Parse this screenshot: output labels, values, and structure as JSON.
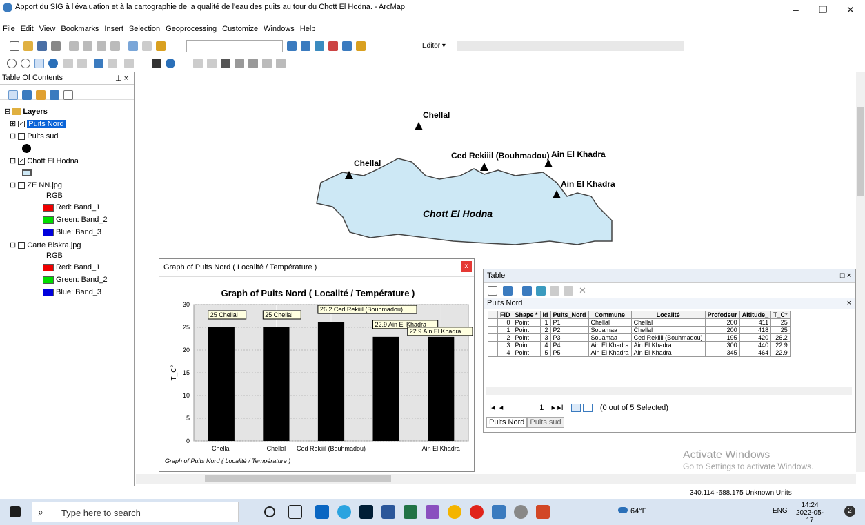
{
  "window": {
    "title": "Apport du SIG à l'évaluation et à la cartographie de la qualité de l'eau des puits au tour du Chott El Hodna. - ArcMap",
    "minimize": "–",
    "maximize": "❐",
    "close": "✕"
  },
  "menu": [
    "File",
    "Edit",
    "View",
    "Bookmarks",
    "Insert",
    "Selection",
    "Geoprocessing",
    "Customize",
    "Windows",
    "Help"
  ],
  "editor_label": "Editor ▾",
  "toc": {
    "title": "Table Of Contents",
    "pin": "⊥ ×",
    "layers_label": "Layers",
    "items": [
      {
        "label": "Puits Nord",
        "checked": "✓"
      },
      {
        "label": "Puits sud",
        "checked": ""
      },
      {
        "label": "Chott El Hodna",
        "checked": "✓"
      },
      {
        "label": "ZE NN.jpg",
        "checked": "",
        "rgb": "RGB",
        "bands": [
          "Red:  Band_1",
          "Green: Band_2",
          "Blue:  Band_3"
        ]
      },
      {
        "label": "Carte Biskra.jpg",
        "checked": "",
        "rgb": "RGB",
        "bands": [
          "Red:  Band_1",
          "Green: Band_2",
          "Blue:  Band_3"
        ]
      }
    ]
  },
  "map": {
    "lake_label": "Chott El Hodna",
    "points": [
      "Chellal",
      "Chellal",
      "Ced Rekiiil (Bouhmadou)",
      "Ain El Khadra",
      "Ain El Khadra"
    ]
  },
  "graph": {
    "window_title": "Graph of Puits Nord ( Localité / Température )",
    "close": "x",
    "title": "Graph of Puits Nord ( Localité / Température )",
    "ylabel": "T_C°",
    "footer": "Graph of Puits Nord ( Localité / Température )"
  },
  "chart_data": {
    "type": "bar",
    "categories": [
      "Chellal",
      "Chellal",
      "Ced Rekiiil (Bouhmadou)",
      "Ain El Khadra",
      "Ain El Khadra"
    ],
    "x_tick_labels": [
      "Chellal",
      "Chellal",
      "Ced Rekiiil (Bouhmadou)",
      "",
      "Ain El Khadra"
    ],
    "values": [
      25,
      25,
      26.2,
      22.9,
      22.9
    ],
    "data_labels": [
      "25 Chellal",
      "25 Chellal",
      "26.2 Ced Rekiiil (Bouhmadou)",
      "22.9 Ain El Khadra",
      "22.9 Ain El Khadra"
    ],
    "title": "Graph of Puits Nord ( Localité / Température )",
    "ylabel": "T_C°",
    "ylim": [
      0,
      30
    ],
    "yticks": [
      0,
      5,
      10,
      15,
      20,
      25,
      30
    ],
    "grid": true,
    "colors": {
      "bar": "#000000",
      "plot_bg": "#e4e4e4"
    }
  },
  "table": {
    "title": "Table",
    "controls": "□ ×",
    "layer": "Puits Nord",
    "layer_close": "×",
    "columns": [
      "FID",
      "Shape *",
      "Id",
      "Puits_Nord",
      "Commune",
      "Localité",
      "Profodeur",
      "Altitude_",
      "T_C°"
    ],
    "rows": [
      [
        "0",
        "Point",
        "1",
        "P1",
        "Chellal",
        "Chellal",
        "200",
        "411",
        "25"
      ],
      [
        "1",
        "Point",
        "2",
        "P2",
        "Souamaa",
        "Chellal",
        "200",
        "418",
        "25"
      ],
      [
        "2",
        "Point",
        "3",
        "P3",
        "Souamaa",
        "Ced Rekiiil (Bouhmadou)",
        "195",
        "420",
        "26.2"
      ],
      [
        "3",
        "Point",
        "4",
        "P4",
        "Ain El Khadra",
        "Ain El Khadra",
        "300",
        "440",
        "22.9"
      ],
      [
        "4",
        "Point",
        "5",
        "P5",
        "Ain El Khadra",
        "Ain El Khadra",
        "345",
        "464",
        "22.9"
      ]
    ],
    "record": "1",
    "selection": "(0 out of 5 Selected)",
    "tabs": [
      "Puits Nord",
      "Puits sud"
    ]
  },
  "status": {
    "coords": "340.114  -688.175 Unknown Units"
  },
  "watermark": {
    "line1": "Activate Windows",
    "line2": "Go to Settings to activate Windows."
  },
  "taskbar": {
    "search": "Type here to search",
    "weather": "64°F",
    "lang": "ENG",
    "time": "14:24",
    "date": "2022-05-17",
    "notif": "2"
  }
}
